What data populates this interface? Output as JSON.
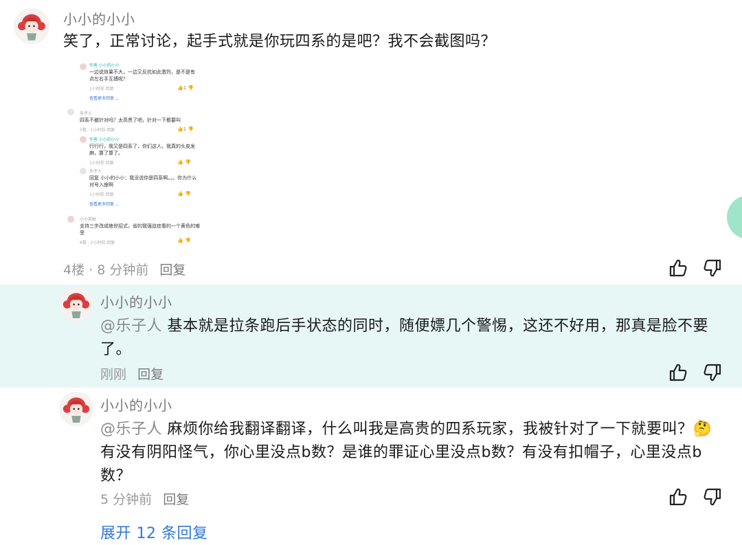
{
  "comments": [
    {
      "name": "小小的小小",
      "text": "笑了，正常讨论，起手式就是你玩四系的是吧？我不会截图吗？",
      "meta": "4楼 · 8 分钟前",
      "reply": "回复"
    },
    {
      "name": "小小的小小",
      "mention": "@乐子人",
      "text": " 基本就是拉条跑后手状态的同时，随便嫖几个警惕，这还不好用，那真是脸不要了。",
      "meta": "刚刚",
      "reply": "回复"
    },
    {
      "name": "小小的小小",
      "mention": "@乐子人",
      "text_a": " 麻烦你给我翻译翻译，什么叫我是高贵的四系玩家，我被针对了一下就要叫？",
      "emoji": "🤔",
      "text_b": "有没有阴阳怪气，你心里没点b数？是谁的罪证心里没点b数？有没有扣帽子，心里没点b数？",
      "meta": "5 分钟前",
      "reply": "回复"
    }
  ],
  "expand_label": "展开 12 条回复",
  "screenshot": {
    "c1_name": "作者 小小的小小",
    "c1_text": "一边说效果不大，一边又反抗如此激烈，是不是有点左右手互搏呢？",
    "c1_meta": "1小时前 回复",
    "c1_likes": "1",
    "c1_more": "查看更多回复 ⌄",
    "c2_name": "乐子人",
    "c2_text": "四系不撤针对吗？太高贵了吧，针对一下都要叫",
    "c2_meta": "5楼 · 1小时前 回复",
    "c2_likes": "1",
    "c3_name": "作者 小小的小小",
    "c3_text": "行行行，我又是四系了，你们这人，我真的头皮发麻，算了算了。",
    "c3_meta": "1小时前 回复",
    "c4_name": "乐子人",
    "c4_text": "回复 小小的小小：我没说你是四系啊。。。你为什么对号入座啊",
    "c4_meta": "1小时前 回复",
    "c4_more": "查看更多回复 ⌄",
    "c5_name": "小小苏秋",
    "c5_text": "支持三步改成绝世招式，省的我强迫症看的一个黄色的难受",
    "c5_meta": "6楼 · 2小时前 回复"
  },
  "colors": {
    "highlight_bg": "#e6f7f6",
    "link": "#2f79d8",
    "author_tag": "#2bb7a5"
  },
  "icons": [
    "avatar-chibi-red-hair",
    "thumbs-up-icon",
    "thumbs-down-icon",
    "chat-bubble-icon"
  ]
}
